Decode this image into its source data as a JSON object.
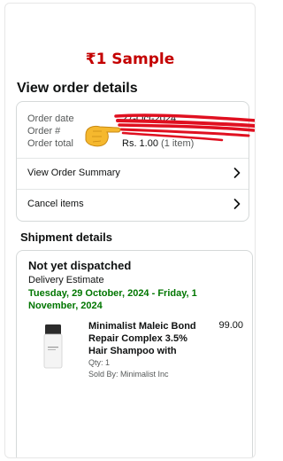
{
  "banner": {
    "text": "₹1 Sample"
  },
  "order_details": {
    "title": "View order details",
    "order_date_label": "Order date",
    "order_date_value": "27-Oct-2024",
    "order_number_label": "Order #",
    "order_total_label": "Order total",
    "order_total_value": "Rs. 1.00",
    "order_total_items": "(1 item)",
    "view_summary_label": "View Order Summary",
    "cancel_items_label": "Cancel items"
  },
  "shipment": {
    "title": "Shipment details",
    "status": "Not yet dispatched",
    "delivery_label": "Delivery Estimate",
    "delivery_date": "Tuesday, 29 October, 2024 - Friday, 1 November, 2024",
    "product": {
      "name": "Minimalist Maleic Bond Repair Complex 3.5% Hair Shampoo with",
      "price": "99.00",
      "qty": "Qty: 1",
      "seller": "Sold By: Minimalist Inc"
    }
  },
  "colors": {
    "banner": "#c40000",
    "delivery_green": "#007600",
    "scribble": "#e01020",
    "emoji": "#f5b82e"
  },
  "icons": [
    "chevron-right-icon",
    "pointing-hand-emoji-icon",
    "shampoo-bottle-icon"
  ]
}
